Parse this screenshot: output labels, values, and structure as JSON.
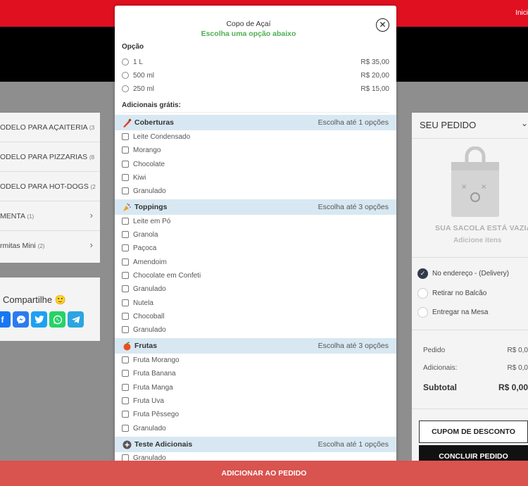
{
  "topbar": {
    "nav_label": "Inici"
  },
  "categories": [
    {
      "label": "ODELO PARA AÇAITERIA",
      "count": "(3"
    },
    {
      "label": "ODELO PARA PIZZARIAS",
      "count": "(8"
    },
    {
      "label": "ODELO PARA HOT-DOGS",
      "count": "(2"
    },
    {
      "label": "MENTA",
      "count": "(1)"
    },
    {
      "label": "rmitas Mini",
      "count": "(2)"
    }
  ],
  "share": {
    "title": "Compartilhe 🙂"
  },
  "order": {
    "title": "SEU PEDIDO",
    "empty_title": "SUA SACOLA ESTÁ VAZIA",
    "empty_sub": "Adicione itens",
    "delivery_options": [
      "No endereço - (Delivery)",
      "Retirar no Balcão",
      "Entregar na Mesa"
    ],
    "summary": {
      "pedido_label": "Pedido",
      "pedido_value": "R$ 0,0",
      "adicionais_label": "Adicionais:",
      "adicionais_value": "R$ 0,0",
      "subtotal_label": "Subtotal",
      "subtotal_value": "R$ 0,00"
    },
    "cupom_label": "CUPOM DE DESCONTO",
    "concluir_label": "CONCLUIR PEDIDO"
  },
  "modal": {
    "title": "Copo de Açaí",
    "subtitle": "Escolha uma opção abaixo",
    "option_label": "Opção",
    "options": [
      {
        "label": "1 L",
        "price": "R$ 35,00"
      },
      {
        "label": "500 ml",
        "price": "R$ 20,00"
      },
      {
        "label": "250 ml",
        "price": "R$ 15,00"
      }
    ],
    "extras_label": "Adicionais grátis:",
    "groups": [
      {
        "name": "Coberturas",
        "note": "Escolha até 1 opções",
        "items": [
          "Leite Condensado",
          "Morango",
          "Chocolate",
          "Kiwi",
          "Granulado"
        ]
      },
      {
        "name": "Toppings",
        "note": "Escolha até 3 opções",
        "items": [
          "Leite em Pó",
          "Granola",
          "Paçoca",
          "Amendoim",
          "Chocolate em Confeti",
          "Granulado",
          "Nutela",
          "Chocoball",
          "Granulado"
        ]
      },
      {
        "name": "Frutas",
        "note": "Escolha até 3 opções",
        "items": [
          "Fruta Morango",
          "Fruta Banana",
          "Fruta Manga",
          "Fruta Uva",
          "Fruta Pêssego",
          "Granulado"
        ]
      },
      {
        "name": "Teste Adicionais",
        "note": "Escolha até 1 opções",
        "items": [
          "Granulado"
        ]
      }
    ],
    "add_button": "ADICIONAR AO PEDIDO"
  },
  "colors": {
    "brand_red": "#e01020",
    "add_button": "#d9534f",
    "subtitle_green": "#4caf50",
    "group_bg": "#d8e8f2"
  }
}
